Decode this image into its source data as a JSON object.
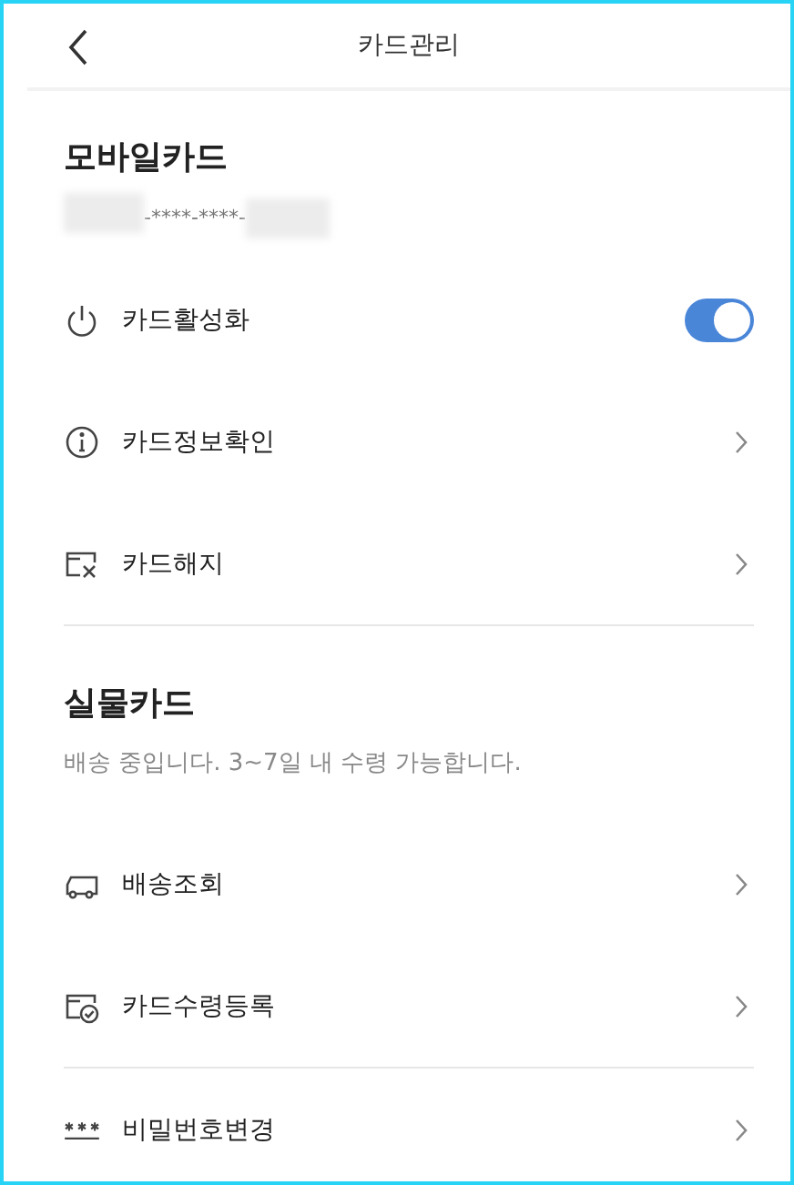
{
  "header": {
    "title": "카드관리"
  },
  "sections": [
    {
      "title": "모바일카드",
      "card_number": "-****-****-",
      "items": [
        {
          "kind": "toggle",
          "label": "카드활성화",
          "on": true
        },
        {
          "kind": "link",
          "label": "카드정보확인"
        },
        {
          "kind": "link",
          "label": "카드해지"
        }
      ]
    },
    {
      "title": "실물카드",
      "note": "배송 중입니다. 3~7일 내 수령 가능합니다.",
      "items": [
        {
          "kind": "link",
          "label": "배송조회"
        },
        {
          "kind": "link",
          "label": "카드수령등록"
        }
      ]
    },
    {
      "items": [
        {
          "kind": "link",
          "label": "비밀번호변경"
        }
      ]
    }
  ]
}
